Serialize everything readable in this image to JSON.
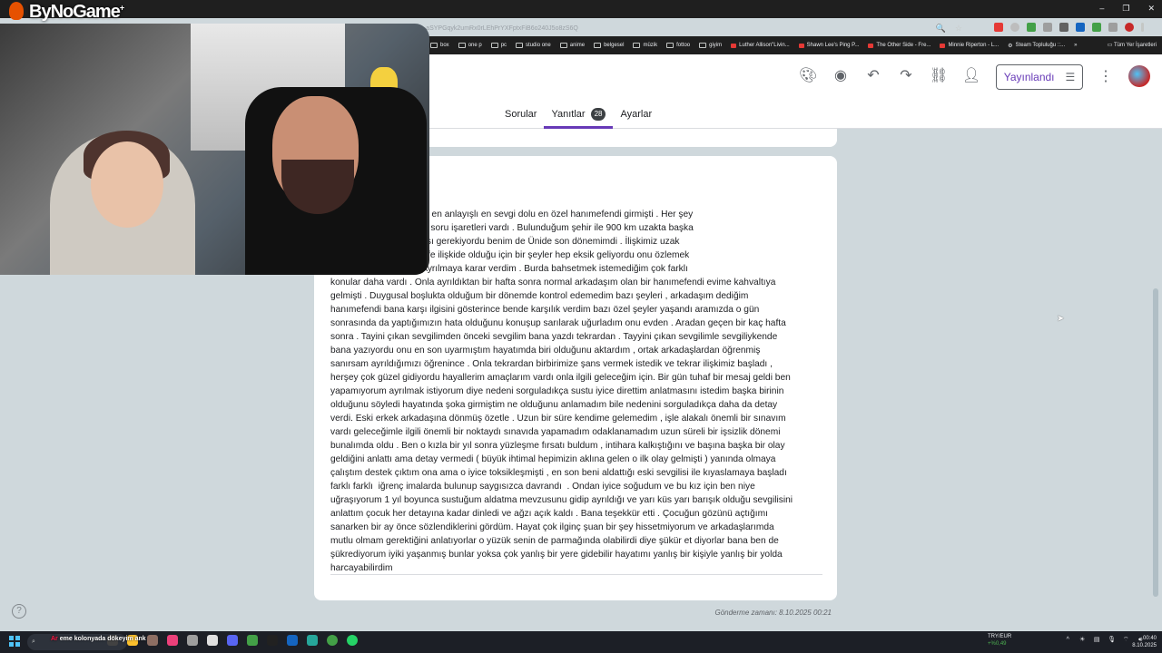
{
  "browser": {
    "url": "...rvKEZ_aSYPGqyk2umRx0rLEhPrYXFptxFiB6o240J5o8zS6Q",
    "bookmarks": [
      "box",
      "one p",
      "pc",
      "studio one",
      "anime",
      "belgesel",
      "müzik",
      "fottoo",
      "giyim",
      "Luther Allison\"Livin...",
      "Shawn Lee's Ping P...",
      "The Other Side - Fre...",
      "Minnie Riperton - L...",
      "Steam Topluluğu ::..."
    ],
    "bookmarks_more": "»",
    "all_bookmarks": "Tüm Yer İşaretleri"
  },
  "forms": {
    "publish_label": "Yayınlandı",
    "tabs": [
      {
        "label": "Sorular"
      },
      {
        "label": "Yanıtlar",
        "badge": "28"
      },
      {
        "label": "Ayarlar"
      }
    ],
    "accent": "#673ab7"
  },
  "response": {
    "answer_lines": [
      "a şu yaşıma kadar giren en anlayışlı en sevgi dolu en özel hanımefendi girmişti . Her şey",
      "tayin durumundan ötürü soru işaretleri vardı . Bulunduğum şehir ile 900 km uzakta başka",
      ". 4 yıl kadar orda kalması gerekiyordu benim de Ünide son dönemimdi . İlişkimiz uzak",
      "6 ay sürdü . Uzak mesafe ilişkide olduğu için bir şeyler hep eksik geliyordu onu özlemek",
      "nması her şey eksikti. Ayrılmaya karar verdim . Burda bahsetmek istemediğim çok farklı",
      "konular daha vardı . Onla ayrıldıktan bir hafta sonra normal arkadaşım olan bir hanımefendi evime kahvaltıya",
      "gelmişti . Duygusal boşlukta olduğum bir dönemde kontrol edemedim bazı şeyleri , arkadaşım dediğim",
      "hanımefendi bana karşı ilgisini gösterince bende karşılık verdim bazı özel şeyler yaşandı aramızda o gün",
      "sonrasında da yaptığımızın hata olduğunu konuşup sarılarak uğurladım onu evden . Aradan geçen bir kaç hafta",
      "sonra . Tayini çıkan sevgilimden önceki sevgilim bana yazdı tekrardan . Tayyini çıkan sevgilimle sevgiliykende",
      "bana yazıyordu onu en son uyarmıştım hayatımda biri olduğunu aktardım , ortak arkadaşlardan öğrenmiş",
      "sanırsam ayrıldığımızı öğrenince . Onla tekrardan birbirimize şans vermek istedik ve tekrar ilişkimiz başladı ,",
      "herşey çok güzel gidiyordu hayallerim amaçlarım vardı onla ilgili geleceğim için. Bir gün tuhaf bir mesaj geldi ben",
      "yapamıyorum ayrılmak istiyorum diye nedeni sorguladıkça sustu iyice direttim anlatmasını istedim başka birinin",
      "olduğunu söyledi hayatında şoka girmiştim ne olduğunu anlamadım bile nedenini sorguladıkça daha da detay",
      "verdi. Eski erkek arkadaşına dönmüş özetle . Uzun bir süre kendime gelemedim , işle alakalı önemli bir sınavım",
      "vardı geleceğimle ilgili önemli bir noktaydı sınavıda yapamadım odaklanamadım uzun süreli bir işsizlik dönemi",
      "bunalımda oldu . Ben o kızla bir yıl sonra yüzleşme fırsatı buldum , intihara kalkıştığını ve başına başka bir olay",
      "geldiğini anlattı ama detay vermedi ( büyük ihtimal hepimizin aklına gelen o ilk olay gelmişti ) yanında olmaya",
      "çalıştım destek çıktım ona ama o iyice toksikleşmişti , en son beni aldattığı eski sevgilisi ile kıyaslamaya başladı",
      "farklı farklı  iğrenç imalarda bulunup saygısızca davrandı  . Ondan iyice soğudum ve bu kız için ben niye",
      "uğraşıyorum 1 yıl boyunca sustuğum aldatma mevzusunu gidip ayrıldığı ve yarı küs yarı barışık olduğu sevgilisini",
      "anlattım çocuk her detayına kadar dinledi ve ağzı açık kaldı . Bana teşekkür etti . Çocuğun gözünü açtığımı",
      "sanarken bir ay önce sözlendiklerini gördüm. Hayat çok ilginç şuan bir şey hissetmiyorum ve arkadaşlarımda",
      "mutlu olmam gerektiğini anlatıyorlar o yüzük senin de parmağında olabilirdi diye şükür et diyorlar bana ben de",
      "şükrediyorum iyiki yaşanmış bunlar yoksa çok yanlış bir yere gidebilir hayatımı yanlış bir kişiyle yanlış bir yolda",
      "harcayabilirdim"
    ],
    "submitted_label": "Gönderme zamanı: 8.10.2025 00:21"
  },
  "overlay": {
    "logo_text": "ByNoGame",
    "logo_plus": "+",
    "ticker_red": "Ar",
    "ticker_white": "eme kolonyada dökeyim ank"
  },
  "taskbar": {
    "currency_pair": "TRY/EUR",
    "currency_change": "+%0,49",
    "time": "00:40",
    "date": "8.10.2025"
  }
}
